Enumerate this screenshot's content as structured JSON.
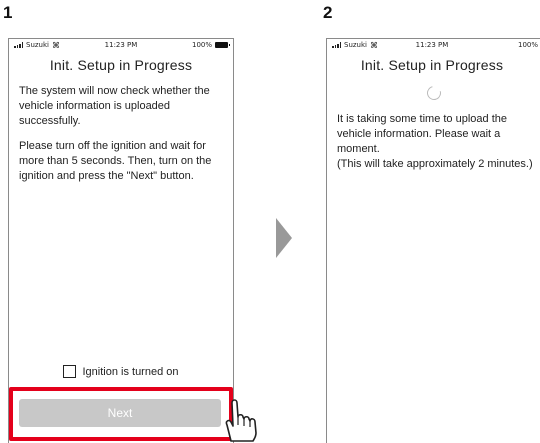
{
  "steps": [
    {
      "number": "1",
      "status": {
        "carrier": "Suzuki",
        "time": "11:23 PM",
        "battery": "100%"
      },
      "title": "Init. Setup in Progress",
      "paragraphs": [
        "The system will now check whether the vehicle information is uploaded successfully.",
        "Please turn off the ignition and wait for more than 5 seconds. Then, turn on the ignition and press the \"Next\" button."
      ],
      "checkbox_label": "Ignition is turned on",
      "checkbox_checked": false,
      "next_label": "Next"
    },
    {
      "number": "2",
      "status": {
        "carrier": "Suzuki",
        "time": "11:23 PM",
        "battery": "100%"
      },
      "title": "Init. Setup in Progress",
      "paragraphs": [
        "It is taking some time to upload the vehicle information. Please wait a moment.",
        "(This will take approximately 2 minutes.)"
      ]
    }
  ],
  "colors": {
    "highlight": "#e4001b",
    "button_disabled": "#c8c8c8",
    "arrow": "#999999"
  },
  "icons": [
    "signal-icon",
    "wifi-icon",
    "battery-icon",
    "loading-spinner-icon",
    "next-step-arrow-icon",
    "pointing-hand-icon"
  ]
}
